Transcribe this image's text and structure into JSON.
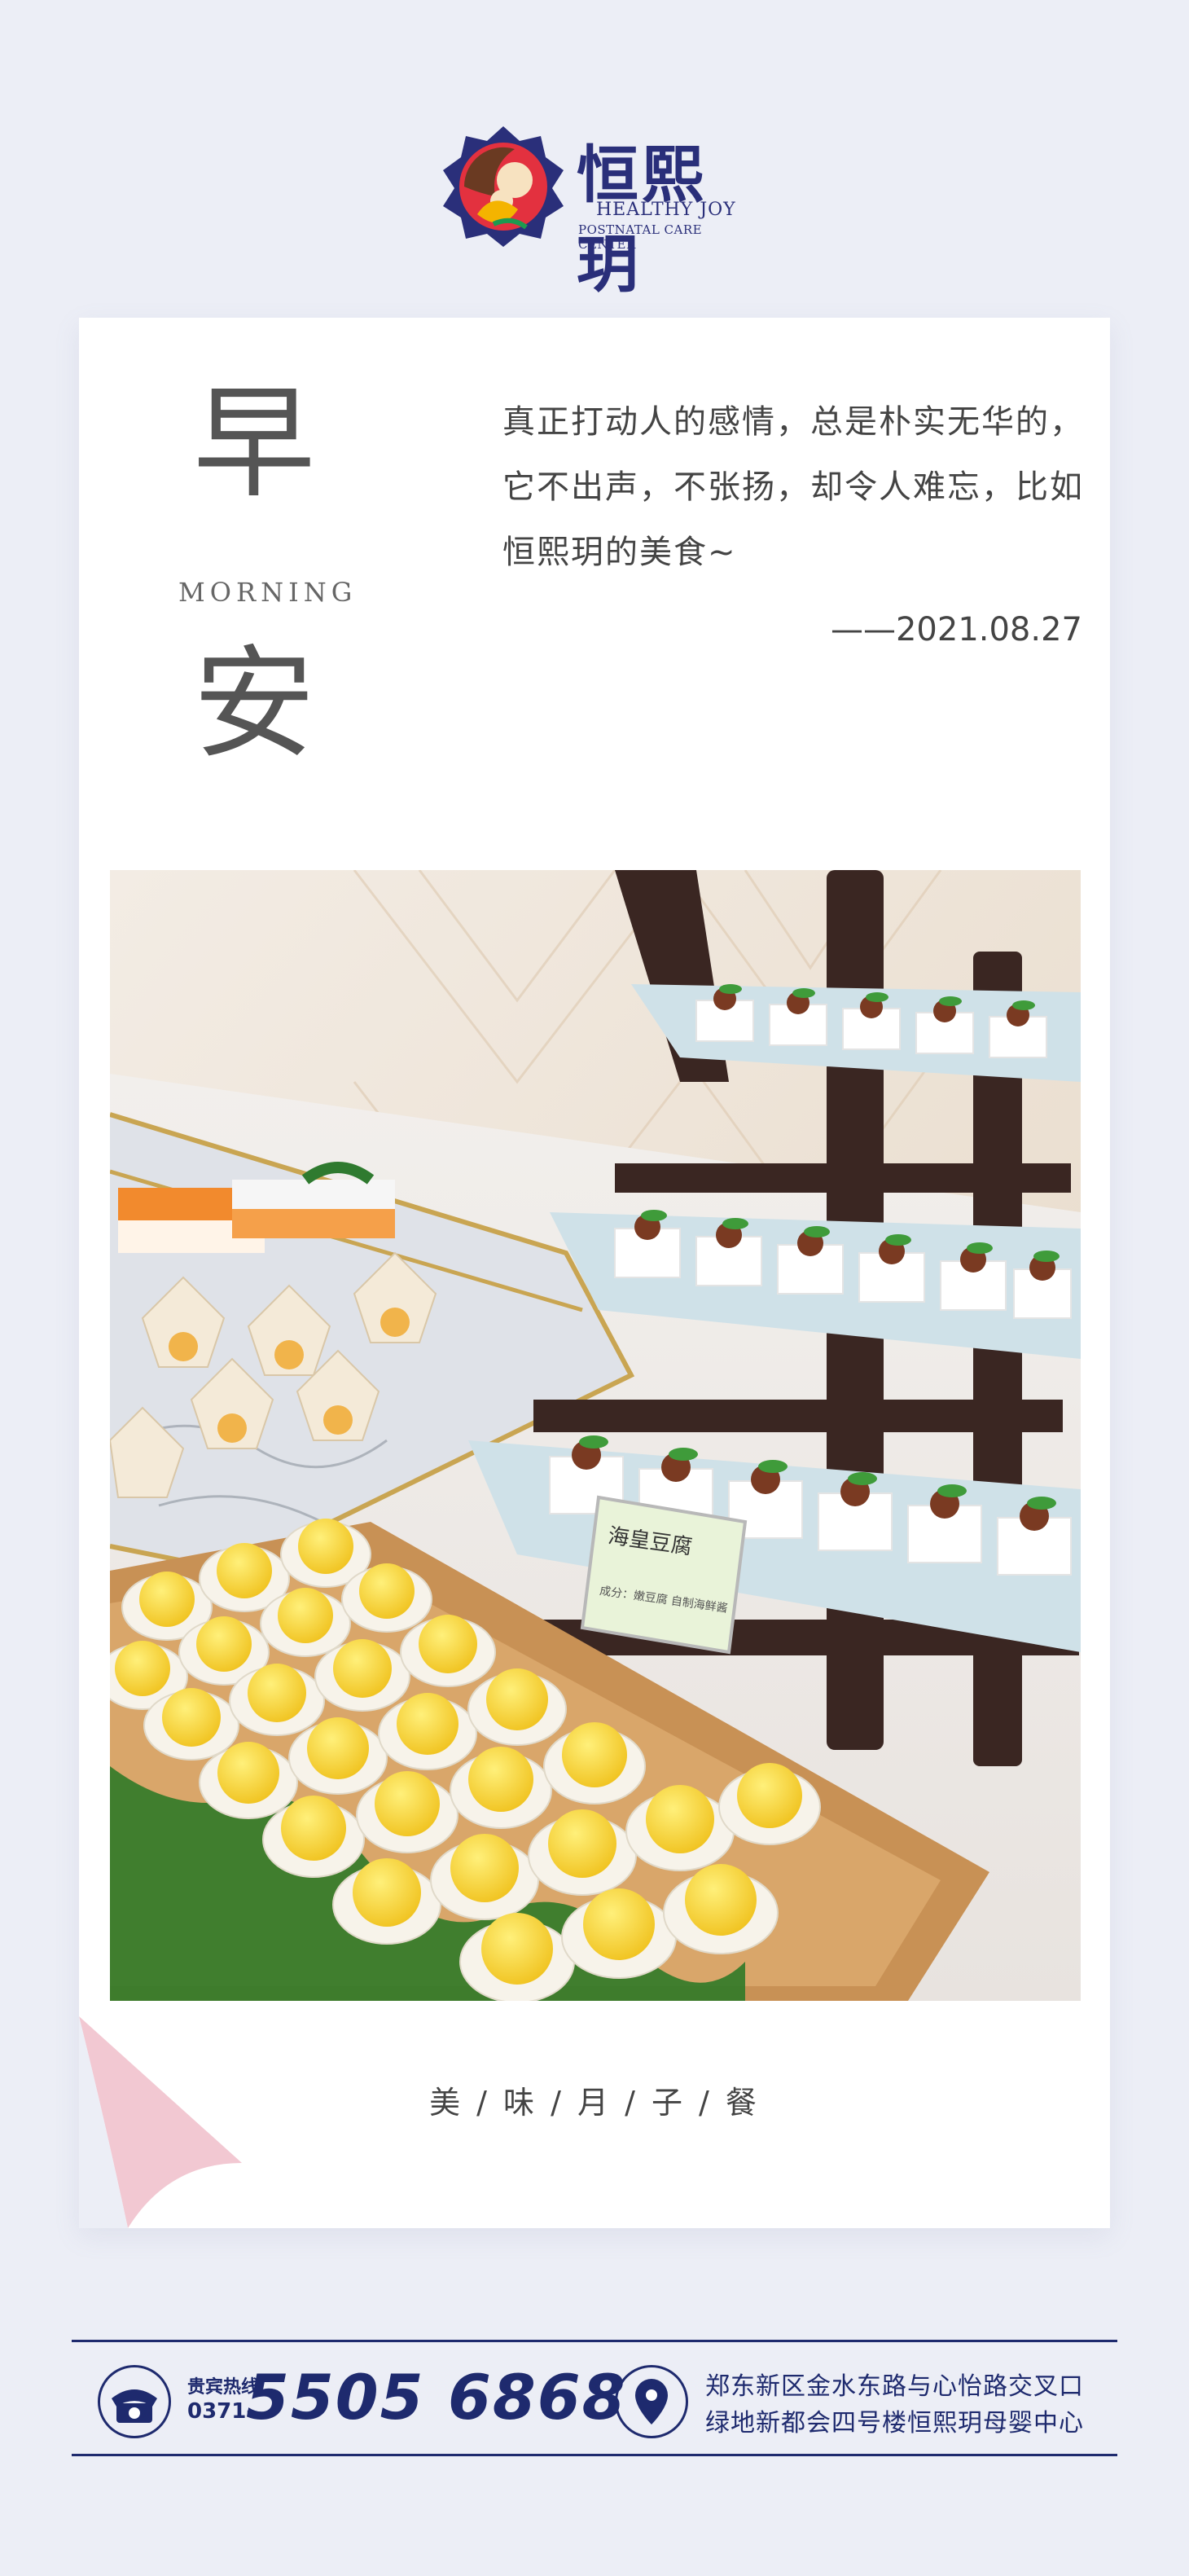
{
  "brand": {
    "name_cn": "恒熙玥",
    "name_en": "HEALTHY JOY",
    "subtitle_en": "POSTNATAL CARE CENTER"
  },
  "greeting": {
    "char1": "早",
    "english": "MORNING",
    "char2": "安"
  },
  "quote": "真正打动人的感情，总是朴实无华的，它不出声，不张扬，却令人难忘，比如恒熙玥的美食~",
  "date": "——2021.08.27",
  "photo": {
    "sign_title": "海皇豆腐",
    "sign_detail": "成分：嫩豆腐   自制海鲜酱"
  },
  "caption": "美 / 味 / 月 / 子 / 餐",
  "footer": {
    "hotline_label": "贵宾热线",
    "area_code": "0371-",
    "phone_number": "5505 6868",
    "address_line1": "郑东新区金水东路与心怡路交叉口",
    "address_line2": "绿地新都会四号楼恒熙玥母婴中心"
  },
  "colors": {
    "background": "#eceef6",
    "brand_navy": "#1e2a6e",
    "egg_yolk": "#f5d033",
    "fold_pink": "#f2c8d2"
  },
  "icons": [
    "brand-logo-icon",
    "phone-icon",
    "location-pin-icon"
  ]
}
